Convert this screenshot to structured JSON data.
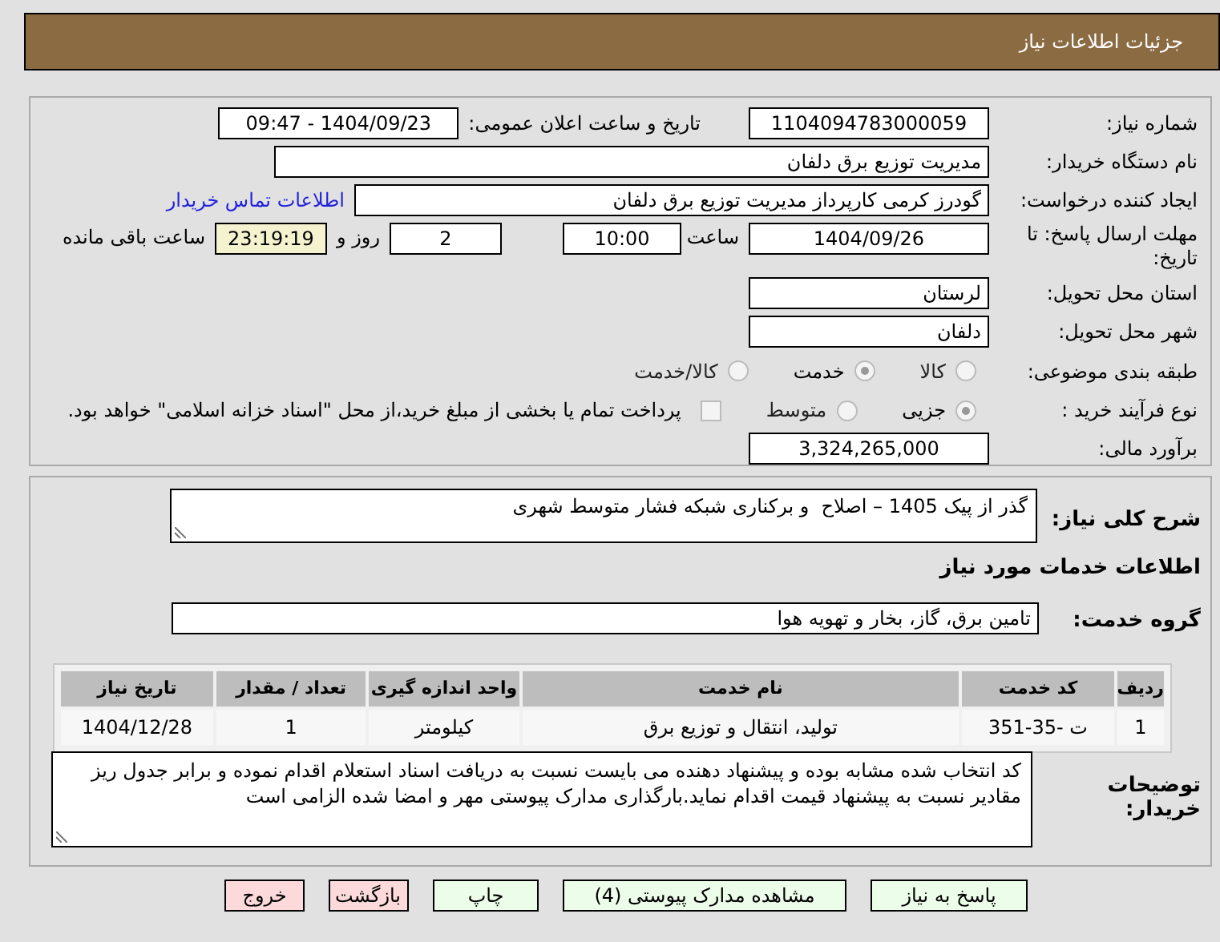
{
  "header": {
    "title": "جزئیات اطلاعات نیاز"
  },
  "need_number": {
    "label": "شماره نیاز:",
    "value": "1104094783000059"
  },
  "announce": {
    "label": "تاریخ و ساعت اعلان عمومی:",
    "value": "1404/09/23 - 09:47"
  },
  "buyer_org": {
    "label": "نام دستگاه خریدار:",
    "value": "مدیریت توزیع برق دلفان"
  },
  "requester": {
    "label": "ایجاد کننده درخواست:",
    "value": "گودرز کرمی کارپرداز مدیریت توزیع برق دلفان",
    "link": "اطلاعات تماس خریدار"
  },
  "deadline": {
    "label": "مهلت ارسال پاسخ: تا تاریخ:",
    "date": "1404/09/26",
    "time_label": "ساعت",
    "time": "10:00",
    "days": "2",
    "days_label": "روز و",
    "remaining": "23:19:19",
    "remaining_label": "ساعت باقی مانده"
  },
  "province": {
    "label": "استان محل تحویل:",
    "value": "لرستان"
  },
  "city": {
    "label": "شهر محل تحویل:",
    "value": "دلفان"
  },
  "category": {
    "label": "طبقه بندی موضوعی:",
    "options": [
      {
        "label": "کالا",
        "selected": false
      },
      {
        "label": "خدمت",
        "selected": true
      },
      {
        "label": "کالا/خدمت",
        "selected": false
      }
    ]
  },
  "process": {
    "label": "نوع فرآیند خرید :",
    "options": [
      {
        "label": "جزیی",
        "selected": true
      },
      {
        "label": "متوسط",
        "selected": false
      }
    ],
    "treasury": {
      "label": "پرداخت تمام یا بخشی از مبلغ خرید،از محل \"اسناد خزانه اسلامی\" خواهد بود.",
      "checked": false
    }
  },
  "budget": {
    "label": "برآورد مالی:",
    "value": "3,324,265,000"
  },
  "description": {
    "label": "شرح کلی نیاز:",
    "value": "گذر از پیک 1405 – اصلاح  و برکناری شبکه فشار متوسط شهری"
  },
  "services_heading": "اطلاعات خدمات مورد نیاز",
  "service_group": {
    "label": "گروه خدمت:",
    "value": "تامین برق، گاز، بخار و تهویه هوا"
  },
  "table": {
    "columns": [
      "ردیف",
      "کد خدمت",
      "نام خدمت",
      "واحد اندازه گیری",
      "تعداد / مقدار",
      "تاریخ نیاز"
    ],
    "rows": [
      [
        "1",
        "ت -35-351",
        "تولید، انتقال و توزیع برق",
        "کیلومتر",
        "1",
        "1404/12/28"
      ]
    ]
  },
  "buyer_notes": {
    "label": "توضیحات خریدار:",
    "value": "کد انتخاب شده مشابه بوده و پیشنهاد دهنده می بایست نسبت به دریافت اسناد استعلام اقدام نموده و برابر جدول ریز مقادیر نسبت به پیشنهاد قیمت اقدام نماید.بارگذاری مدارک پیوستی مهر و امضا شده الزامی است"
  },
  "buttons": [
    {
      "label": "پاسخ به نیاز",
      "kind": "action"
    },
    {
      "label": "مشاهده مدارک پیوستی (4)",
      "kind": "action"
    },
    {
      "label": "چاپ",
      "kind": "action"
    },
    {
      "label": "بازگشت",
      "kind": "danger"
    },
    {
      "label": "خروج",
      "kind": "danger"
    }
  ]
}
